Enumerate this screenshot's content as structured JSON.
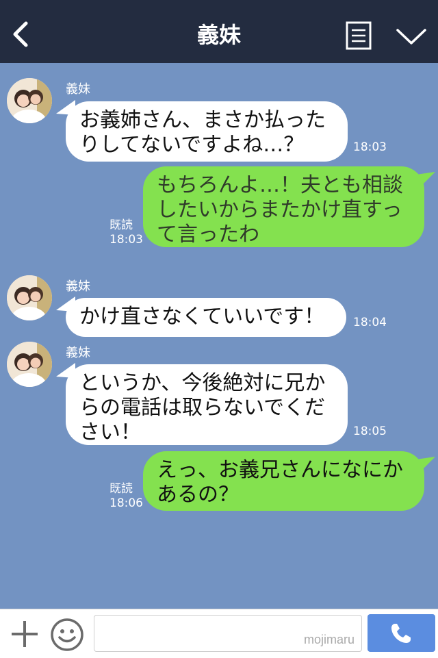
{
  "header": {
    "title": "義妹",
    "back_icon": "chevron-left-icon",
    "menu_icon": "document-icon",
    "dropdown_icon": "chevron-down-icon"
  },
  "messages": [
    {
      "side": "in",
      "sender": "義妹",
      "text": "お義姉さん、まさか払ったりしてないですよね…？",
      "time": "18:03"
    },
    {
      "side": "out",
      "read": "既読",
      "text": "もちろんよ…！夫とも相談したいからまたかけ直すって言ったわ",
      "time": "18:03"
    },
    {
      "side": "in",
      "sender": "義妹",
      "text": "かけ直さなくていいです！",
      "time": "18:04"
    },
    {
      "side": "in",
      "sender": "義妹",
      "text": "というか、今後絶対に兄からの電話は取らないでください！",
      "time": "18:05"
    },
    {
      "side": "out",
      "read": "既読",
      "text": "えっ、お義兄さんになにかあるの？",
      "time": "18:06"
    }
  ],
  "input_bar": {
    "plus_icon": "plus-icon",
    "emoji_icon": "smiley-icon",
    "watermark": "mojimaru",
    "call_icon": "phone-icon"
  },
  "colors": {
    "header_bg": "#232c40",
    "chat_bg": "#7393c2",
    "incoming_bubble": "#ffffff",
    "outgoing_bubble": "#84e14f",
    "call_button": "#5b8de0"
  }
}
